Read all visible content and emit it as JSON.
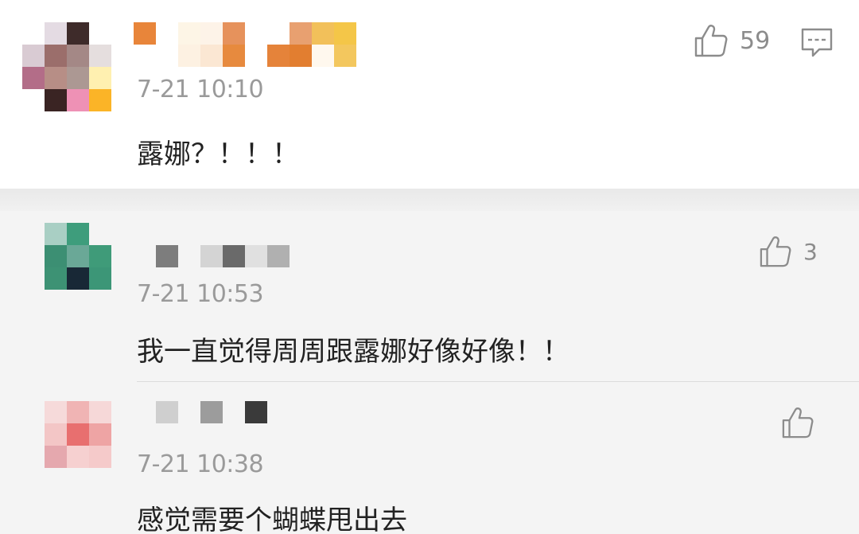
{
  "main_comment": {
    "timestamp": "7-21 10:10",
    "text": "露娜？！！！",
    "like_count": "59",
    "like_icon": "thumbs-up-icon",
    "comment_icon": "comment-bubble-icon"
  },
  "replies": [
    {
      "timestamp": "7-21 10:53",
      "text": "我一直觉得周周跟露娜好像好像！！",
      "like_count": "3",
      "like_icon": "thumbs-up-icon"
    },
    {
      "timestamp": "7-21 10:38",
      "text": "感觉需要个蝴蝶甩出去",
      "like_count": "",
      "like_icon": "thumbs-up-icon"
    }
  ],
  "colors": {
    "primary_text": "#222222",
    "secondary_text": "#9a9a9a",
    "icon": "#8c8c8c",
    "main_background": "#ffffff",
    "reply_background": "#f4f4f4"
  }
}
